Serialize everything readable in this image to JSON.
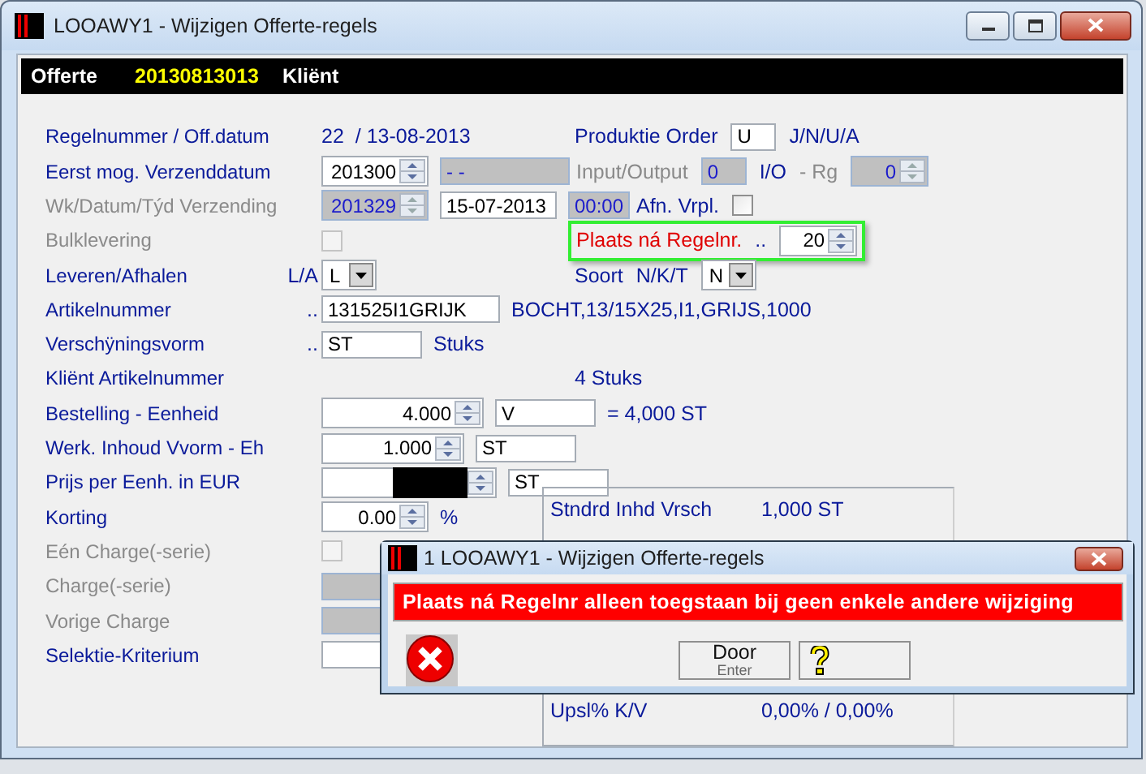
{
  "window": {
    "title": "LOOAWY1 - Wijzigen Offerte-regels"
  },
  "header": {
    "label": "Offerte",
    "number": "20130813013",
    "client_label": "Kliënt"
  },
  "rows": [
    {
      "label": "Regelnummer / Off.datum",
      "disabled": false,
      "controls": [
        {
          "kind": "text",
          "text": "22"
        },
        {
          "kind": "text",
          "text": "/ 13-08-2013"
        }
      ],
      "right": {
        "highlighted": false,
        "items": [
          {
            "kind": "label",
            "text": "Produktie Order",
            "disabled": false,
            "error": false
          },
          {
            "kind": "field",
            "value": "U",
            "disabled": false
          },
          {
            "kind": "text",
            "text": "J/N/U/A"
          }
        ]
      }
    },
    {
      "label": "Eerst mog. Verzenddatum",
      "disabled": false,
      "controls": [
        {
          "kind": "spin",
          "value": "201300",
          "disabled": false
        },
        {
          "kind": "field",
          "value": "- -",
          "disabled": true
        }
      ],
      "right": {
        "highlighted": false,
        "items": [
          {
            "kind": "label",
            "text": "Input/Output",
            "disabled": true,
            "error": false
          },
          {
            "kind": "field",
            "value": "0",
            "disabled": true
          },
          {
            "kind": "text",
            "text": "I/O"
          },
          {
            "kind": "label",
            "text": "- Rg",
            "disabled": true,
            "error": false
          },
          {
            "kind": "spin",
            "value": "0",
            "disabled": true
          }
        ]
      }
    },
    {
      "label": "Wk/Datum/Týd Verzending",
      "disabled": true,
      "controls": [
        {
          "kind": "spin",
          "value": "201329",
          "disabled": true
        },
        {
          "kind": "field",
          "value": "15-07-2013",
          "disabled": false
        },
        {
          "kind": "field",
          "value": "00:00",
          "disabled": true
        }
      ],
      "right": {
        "highlighted": false,
        "items": [
          {
            "kind": "label",
            "text": "Afn. Vrpl.",
            "disabled": false,
            "error": false
          },
          {
            "kind": "checkbox",
            "checked": false,
            "disabled": false
          }
        ]
      }
    },
    {
      "label": "Bulklevering",
      "disabled": true,
      "controls": [
        {
          "kind": "checkbox",
          "checked": false,
          "disabled": true
        }
      ],
      "right": {
        "highlighted": true,
        "items": [
          {
            "kind": "label",
            "text": "Plaats ná Regelnr.",
            "disabled": false,
            "error": true
          },
          {
            "kind": "text",
            "text": ".."
          },
          {
            "kind": "spin",
            "value": "20",
            "disabled": false
          }
        ]
      }
    },
    {
      "label": "Leveren/Afhalen",
      "hint": "L/A",
      "disabled": false,
      "controls": [
        {
          "kind": "select",
          "value": "L"
        }
      ],
      "right": {
        "highlighted": false,
        "items": [
          {
            "kind": "label",
            "text": "Soort",
            "disabled": false,
            "error": false
          },
          {
            "kind": "text",
            "text": "N/K/T"
          },
          {
            "kind": "select",
            "value": "N"
          }
        ]
      }
    },
    {
      "label": "Artikelnummer",
      "hint": "..",
      "disabled": false,
      "controls": [
        {
          "kind": "field",
          "value": "131525I1GRIJK",
          "disabled": false
        },
        {
          "kind": "text",
          "text": "BOCHT,13/15X25,I1,GRIJS,1000"
        }
      ]
    },
    {
      "label": "Verschÿningsvorm",
      "hint": "..",
      "disabled": false,
      "controls": [
        {
          "kind": "field",
          "value": "ST",
          "disabled": false
        },
        {
          "kind": "text",
          "text": "Stuks"
        }
      ]
    },
    {
      "label": "Kliënt Artikelnummer",
      "disabled": false,
      "controls": [],
      "right": {
        "highlighted": false,
        "items": [
          {
            "kind": "text",
            "text": "4 Stuks"
          }
        ]
      }
    },
    {
      "label": "Bestelling - Eenheid",
      "disabled": false,
      "controls": [
        {
          "kind": "spin",
          "value": "4.000",
          "disabled": false
        },
        {
          "kind": "field",
          "value": "V",
          "disabled": false
        },
        {
          "kind": "text",
          "text": "= 4,000 ST"
        }
      ]
    },
    {
      "label": "Werk. Inhoud Vvorm - Eh",
      "disabled": false,
      "controls": [
        {
          "kind": "spin",
          "value": "1.000",
          "disabled": false
        },
        {
          "kind": "field",
          "value": "ST",
          "disabled": false
        }
      ]
    },
    {
      "label": "Prijs per Eenh. in EUR",
      "disabled": false,
      "controls": [
        {
          "kind": "redacted-spin"
        },
        {
          "kind": "field",
          "value": "ST",
          "disabled": false
        }
      ]
    }
  ],
  "lower_rows": [
    {
      "label": "Korting",
      "disabled": false,
      "controls": [
        {
          "kind": "spin",
          "value": "0.00",
          "disabled": false
        },
        {
          "kind": "text",
          "text": "%"
        }
      ]
    },
    {
      "label": "Eén Charge(-serie)",
      "disabled": true,
      "controls": [
        {
          "kind": "checkbox",
          "checked": false,
          "disabled": true
        }
      ]
    },
    {
      "label": "Charge(-serie)",
      "disabled": true,
      "controls": [
        {
          "kind": "field",
          "disabled": true
        }
      ]
    },
    {
      "label": "Vorige Charge",
      "disabled": true,
      "controls": [
        {
          "kind": "field",
          "disabled": true
        }
      ]
    },
    {
      "label": "Selektie-Kriterium",
      "disabled": false,
      "controls": [
        {
          "kind": "field",
          "disabled": false
        }
      ]
    }
  ],
  "totals_panel": [
    {
      "label": "Stndrd Inhd Vrsch",
      "value": "1,000 ST"
    },
    {
      "label": "Upsl% K/V",
      "value": "0,00% / 0,00%"
    }
  ],
  "dialog": {
    "title": "1 LOOAWY1 - Wijzigen Offerte-regels",
    "message": "Plaats ná Regelnr alleen toegstaan bij geen enkele andere wijziging",
    "buttons": [
      {
        "kind": "default",
        "label": "Door",
        "shortcut": "Enter"
      },
      {
        "kind": "help"
      }
    ]
  }
}
